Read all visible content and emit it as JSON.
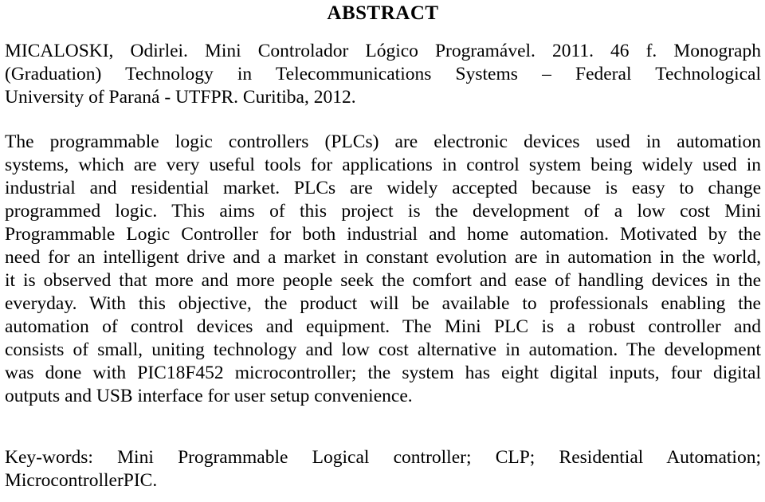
{
  "document": {
    "title": "ABSTRACT",
    "citation": {
      "lines": [
        "MICALOSKI, Odirlei. Mini Controlador Lógico Programável. 2011. 46 f. Monograph",
        "(Graduation) Technology in Telecommunications Systems – Federal Technological",
        "University of Paraná - UTFPR. Curitiba, 2012."
      ],
      "full_text": "MICALOSKI, Odirlei. Mini Controlador Lógico Programável. 2011. 46 f. Monograph (Graduation) Technology in Telecommunications Systems – Federal Technological University of Paraná - UTFPR. Curitiba, 2012.",
      "author": "MICALOSKI, Odirlei",
      "work_title": "Mini Controlador Lógico Programável",
      "year_of_work": "2011",
      "pages": "46 f.",
      "type": "Monograph (Graduation)",
      "program": "Technology in Telecommunications Systems",
      "institution": "Federal Technological University of Paraná - UTFPR",
      "city": "Curitiba",
      "year_published": "2012"
    },
    "abstract": {
      "lines": [
        "The programmable logic controllers (PLCs) are electronic devices used in automation",
        "systems, which are very useful tools for applications in control system being widely used in",
        "industrial and residential market. PLCs are widely accepted because is easy to change",
        "programmed logic. This aims of this project is the development of a low cost Mini",
        "Programmable Logic Controller for both industrial and home automation. Motivated by the",
        "need for an intelligent drive and a market in constant evolution are in automation in the world,",
        "it is observed that more and more people seek the comfort and ease of handling devices in the",
        "everyday. With this objective, the product will be available to professionals enabling the",
        "automation of control devices and equipment. The Mini PLC is a robust controller and",
        "consists of small, uniting technology and low cost alternative in automation. The development",
        "was done with PIC18F452 microcontroller; the system has eight digital inputs, four digital",
        "outputs and USB interface for user setup convenience."
      ],
      "full_text": "The programmable logic controllers (PLCs) are electronic devices used in automation systems, which are very useful tools for applications in control system being widely used in industrial and residential market. PLCs are widely accepted because is easy to change programmed logic. This aims of this project is the development of a low cost Mini Programmable Logic Controller for both industrial and home automation. Motivated by the need for an intelligent drive and a market in constant evolution are in automation in the world, it is observed that more and more people seek the comfort and ease of handling devices in the everyday. With this objective, the product will be available to professionals enabling the automation of control devices and equipment. The Mini PLC is a robust controller and consists of small, uniting technology and low cost alternative in automation. The development was done with PIC18F452 microcontroller; the system has eight digital inputs, four digital outputs and USB interface for user setup convenience."
    },
    "keywords": {
      "lines": [
        "Key-words: Mini Programmable Logical controller; CLP; Residential Automation;",
        "MicrocontrollerPIC."
      ],
      "label": "Key-words:",
      "full_text": "Key-words: Mini Programmable Logical controller; CLP; Residential Automation; MicrocontrollerPIC.",
      "terms": [
        "Mini Programmable Logical controller",
        "CLP",
        "Residential Automation",
        "MicrocontrollerPIC"
      ]
    },
    "colors": {
      "page_background": "#ffffff",
      "text": "#000000"
    }
  }
}
